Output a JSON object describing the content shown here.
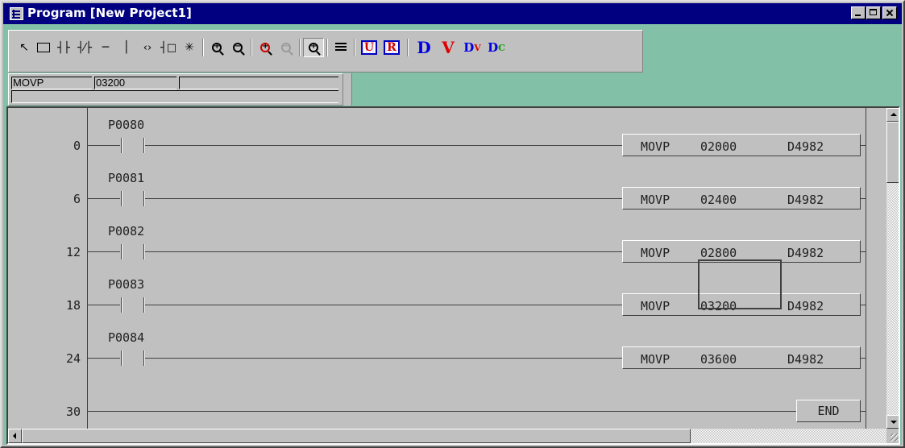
{
  "window": {
    "title": "Program [New Project1]"
  },
  "toolbar": {
    "tools": [
      {
        "name": "select-pointer",
        "glyph": "↖"
      },
      {
        "name": "box",
        "glyph": "□"
      },
      {
        "name": "contact-no",
        "glyph": "┤├"
      },
      {
        "name": "contact-nc",
        "glyph": "┤/├"
      },
      {
        "name": "horizontal-line",
        "glyph": "─"
      },
      {
        "name": "vertical-line",
        "glyph": "│"
      },
      {
        "name": "coil",
        "glyph": "‹›"
      },
      {
        "name": "function-block",
        "glyph": "┤□"
      },
      {
        "name": "special",
        "glyph": "✳"
      },
      {
        "name": "zoom-in",
        "glyph": "+"
      },
      {
        "name": "zoom-out",
        "glyph": "−"
      },
      {
        "name": "zoom-in-red",
        "glyph": "+"
      },
      {
        "name": "zoom-out-gray",
        "glyph": "−"
      },
      {
        "name": "zoom-fit",
        "glyph": "+"
      },
      {
        "name": "comment",
        "glyph": ""
      },
      {
        "name": "mark-u",
        "glyph": "U"
      },
      {
        "name": "mark-r",
        "glyph": "R"
      },
      {
        "name": "device-d",
        "glyph": "D"
      },
      {
        "name": "device-v",
        "glyph": "V"
      },
      {
        "name": "device-dv",
        "glyph": "DV"
      },
      {
        "name": "device-dc",
        "glyph": "DC"
      }
    ],
    "colors": {
      "d": "#0000e0",
      "v": "#e00000",
      "dc": "#00a000"
    }
  },
  "instruction_bar": {
    "mnemonic": "MOVP",
    "operand1": "03200",
    "operand2": "",
    "comment": ""
  },
  "ladder": {
    "rungs": [
      {
        "step": "0",
        "contact": "P0080",
        "instruction": "MOVP",
        "src": "02000",
        "dst": "D4982"
      },
      {
        "step": "6",
        "contact": "P0081",
        "instruction": "MOVP",
        "src": "02400",
        "dst": "D4982"
      },
      {
        "step": "12",
        "contact": "P0082",
        "instruction": "MOVP",
        "src": "02800",
        "dst": "D4982"
      },
      {
        "step": "18",
        "contact": "P0083",
        "instruction": "MOVP",
        "src": "03200",
        "dst": "D4982"
      },
      {
        "step": "24",
        "contact": "P0084",
        "instruction": "MOVP",
        "src": "03600",
        "dst": "D4982"
      }
    ],
    "end_rung": {
      "step": "30",
      "instruction": "END"
    }
  },
  "colors": {
    "titlebar": "#000080",
    "client_background": "#82c0a8",
    "editor_background": "#c0c0c0"
  }
}
